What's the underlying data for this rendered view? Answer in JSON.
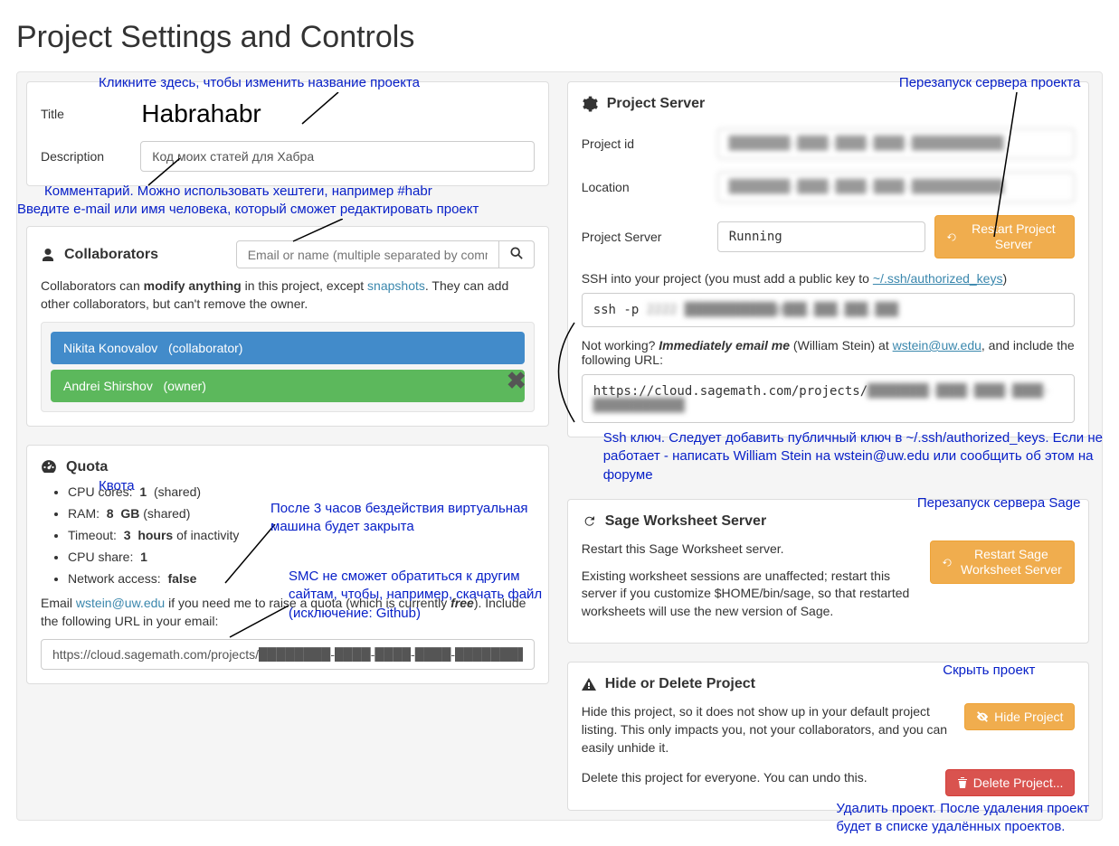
{
  "page_title": "Project Settings and Controls",
  "title_section": {
    "label": "Title",
    "value": "Habrahabr",
    "desc_label": "Description",
    "desc_value": "Код моих статей для Хабра"
  },
  "annotations": {
    "title_hint": "Кликните здесь, чтобы изменить название проекта",
    "desc_hint": "Комментарий. Можно использовать хештеги, например #habr",
    "collab_hint": "Введите e-mail или имя человека, который сможет редактировать проект",
    "quota_header": "Квота",
    "quota_timeout": "После 3 часов бездействия виртуальная машина будет закрыта",
    "quota_network": "SMC не сможет обратиться к другим сайтам, чтобы, например, скачать файл (исключение: Github)",
    "restart_server": "Перезапуск сервера проекта",
    "ssh_hint": "Ssh ключ. Следует добавить публичный ключ в ~/.ssh/authorized_keys. Если не работает - написать William Stein на wstein@uw.edu или сообщить об этом на форуме",
    "restart_sage": "Перезапуск сервера Sage",
    "hide_hint": "Скрыть проект",
    "delete_hint": "Удалить проект. После удаления проект будет в списке удалённых проектов."
  },
  "collaborators": {
    "header": "Collaborators",
    "search_placeholder": "Email or name (multiple separated by commas)",
    "help_prefix": "Collaborators can ",
    "help_bold": "modify anything",
    "help_mid": " in this project, except ",
    "help_link": "snapshots",
    "help_suffix": ". They can add other collaborators, but can't remove the owner.",
    "items": [
      {
        "name": "Nikita Konovalov",
        "role": "(collaborator)"
      },
      {
        "name": "Andrei Shirshov",
        "role": "(owner)"
      }
    ]
  },
  "quota": {
    "header": "Quota",
    "cpu_cores_label": "CPU cores:",
    "cpu_cores_value": "1",
    "cpu_cores_suffix": "(shared)",
    "ram_label": "RAM:",
    "ram_value": "8",
    "ram_unit": "GB",
    "ram_suffix": "(shared)",
    "timeout_label": "Timeout:",
    "timeout_value": "3",
    "timeout_unit": "hours",
    "timeout_suffix": "of inactivity",
    "cpu_share_label": "CPU share:",
    "cpu_share_value": "1",
    "network_label": "Network access:",
    "network_value": "false",
    "email_prefix": "Email ",
    "email_link": "wstein@uw.edu",
    "email_mid": " if you need me to raise a quota (which is currently ",
    "email_free": "free",
    "email_suffix": "). Include the following URL in your email:",
    "url": "https://cloud.sagemath.com/projects/████████-████-████-████-████████████"
  },
  "server": {
    "header": "Project Server",
    "id_label": "Project id",
    "id_value": "████████-████-████-████-████████████",
    "loc_label": "Location",
    "loc_value": "████████-████-████-████-████████████",
    "status_label": "Project Server",
    "status_value": "Running",
    "restart_label": "Restart Project Server",
    "ssh_prefix": "SSH into your project ",
    "ssh_paren": "(you must add a public key to ",
    "ssh_link": "~/.ssh/authorized_keys",
    "ssh_paren_close": ")",
    "ssh_cmd_prefix": "ssh -p ",
    "ssh_cmd_blur": "2222 ████████████@███.███.███.███",
    "notworking_prefix": "Not working? ",
    "notworking_bold": "Immediately email me",
    "notworking_mid": " (William Stein) at ",
    "notworking_email": "wstein@uw.edu",
    "notworking_suffix": ", and include the following URL:",
    "url_prefix": "https://cloud.sagemath.com/projects/",
    "url_blur": "████████-████-████-████-████████████"
  },
  "sage": {
    "header": "Sage Worksheet Server",
    "desc1": "Restart this Sage Worksheet server.",
    "desc2": "Existing worksheet sessions are unaffected; restart this server if you customize $HOME/bin/sage, so that restarted worksheets will use the new version of Sage.",
    "restart_label": "Restart Sage Worksheet Server"
  },
  "hide_delete": {
    "header": "Hide or Delete Project",
    "hide_desc": "Hide this project, so it does not show up in your default project listing. This only impacts you, not your collaborators, and you can easily unhide it.",
    "delete_desc": "Delete this project for everyone. You can undo this.",
    "hide_btn": "Hide Project",
    "delete_btn": "Delete Project..."
  }
}
